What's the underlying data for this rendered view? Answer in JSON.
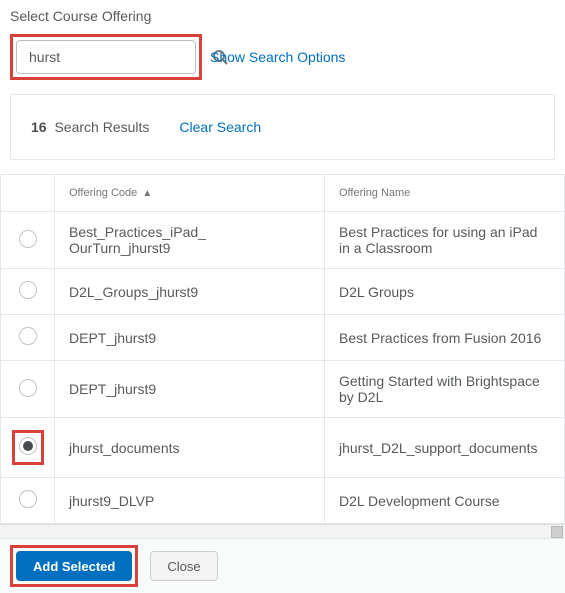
{
  "title": "Select Course Offering",
  "search": {
    "value": "hurst",
    "options_link": "Show Search Options"
  },
  "results": {
    "count": "16",
    "label": "Search Results",
    "clear": "Clear Search"
  },
  "columns": {
    "code": "Offering Code",
    "name": "Offering Name"
  },
  "rows": [
    {
      "code": "Best_Practices_iPad_\nOurTurn_jhurst9",
      "name": "Best Practices for using an iPad in a Classroom",
      "selected": false
    },
    {
      "code": "D2L_Groups_jhurst9",
      "name": "D2L Groups",
      "selected": false
    },
    {
      "code": "DEPT_jhurst9",
      "name": "Best Practices from Fusion 2016",
      "selected": false
    },
    {
      "code": "DEPT_jhurst9",
      "name": "Getting Started with Brightspace by D2L",
      "selected": false
    },
    {
      "code": "jhurst_documents",
      "name": "jhurst_D2L_support_documents",
      "selected": true,
      "highlighted": true
    },
    {
      "code": "jhurst9_DLVP",
      "name": "D2L Development Course",
      "selected": false
    }
  ],
  "buttons": {
    "add": "Add Selected",
    "close": "Close"
  },
  "highlight_color": "#d8413a",
  "primary_color": "#006fbf"
}
